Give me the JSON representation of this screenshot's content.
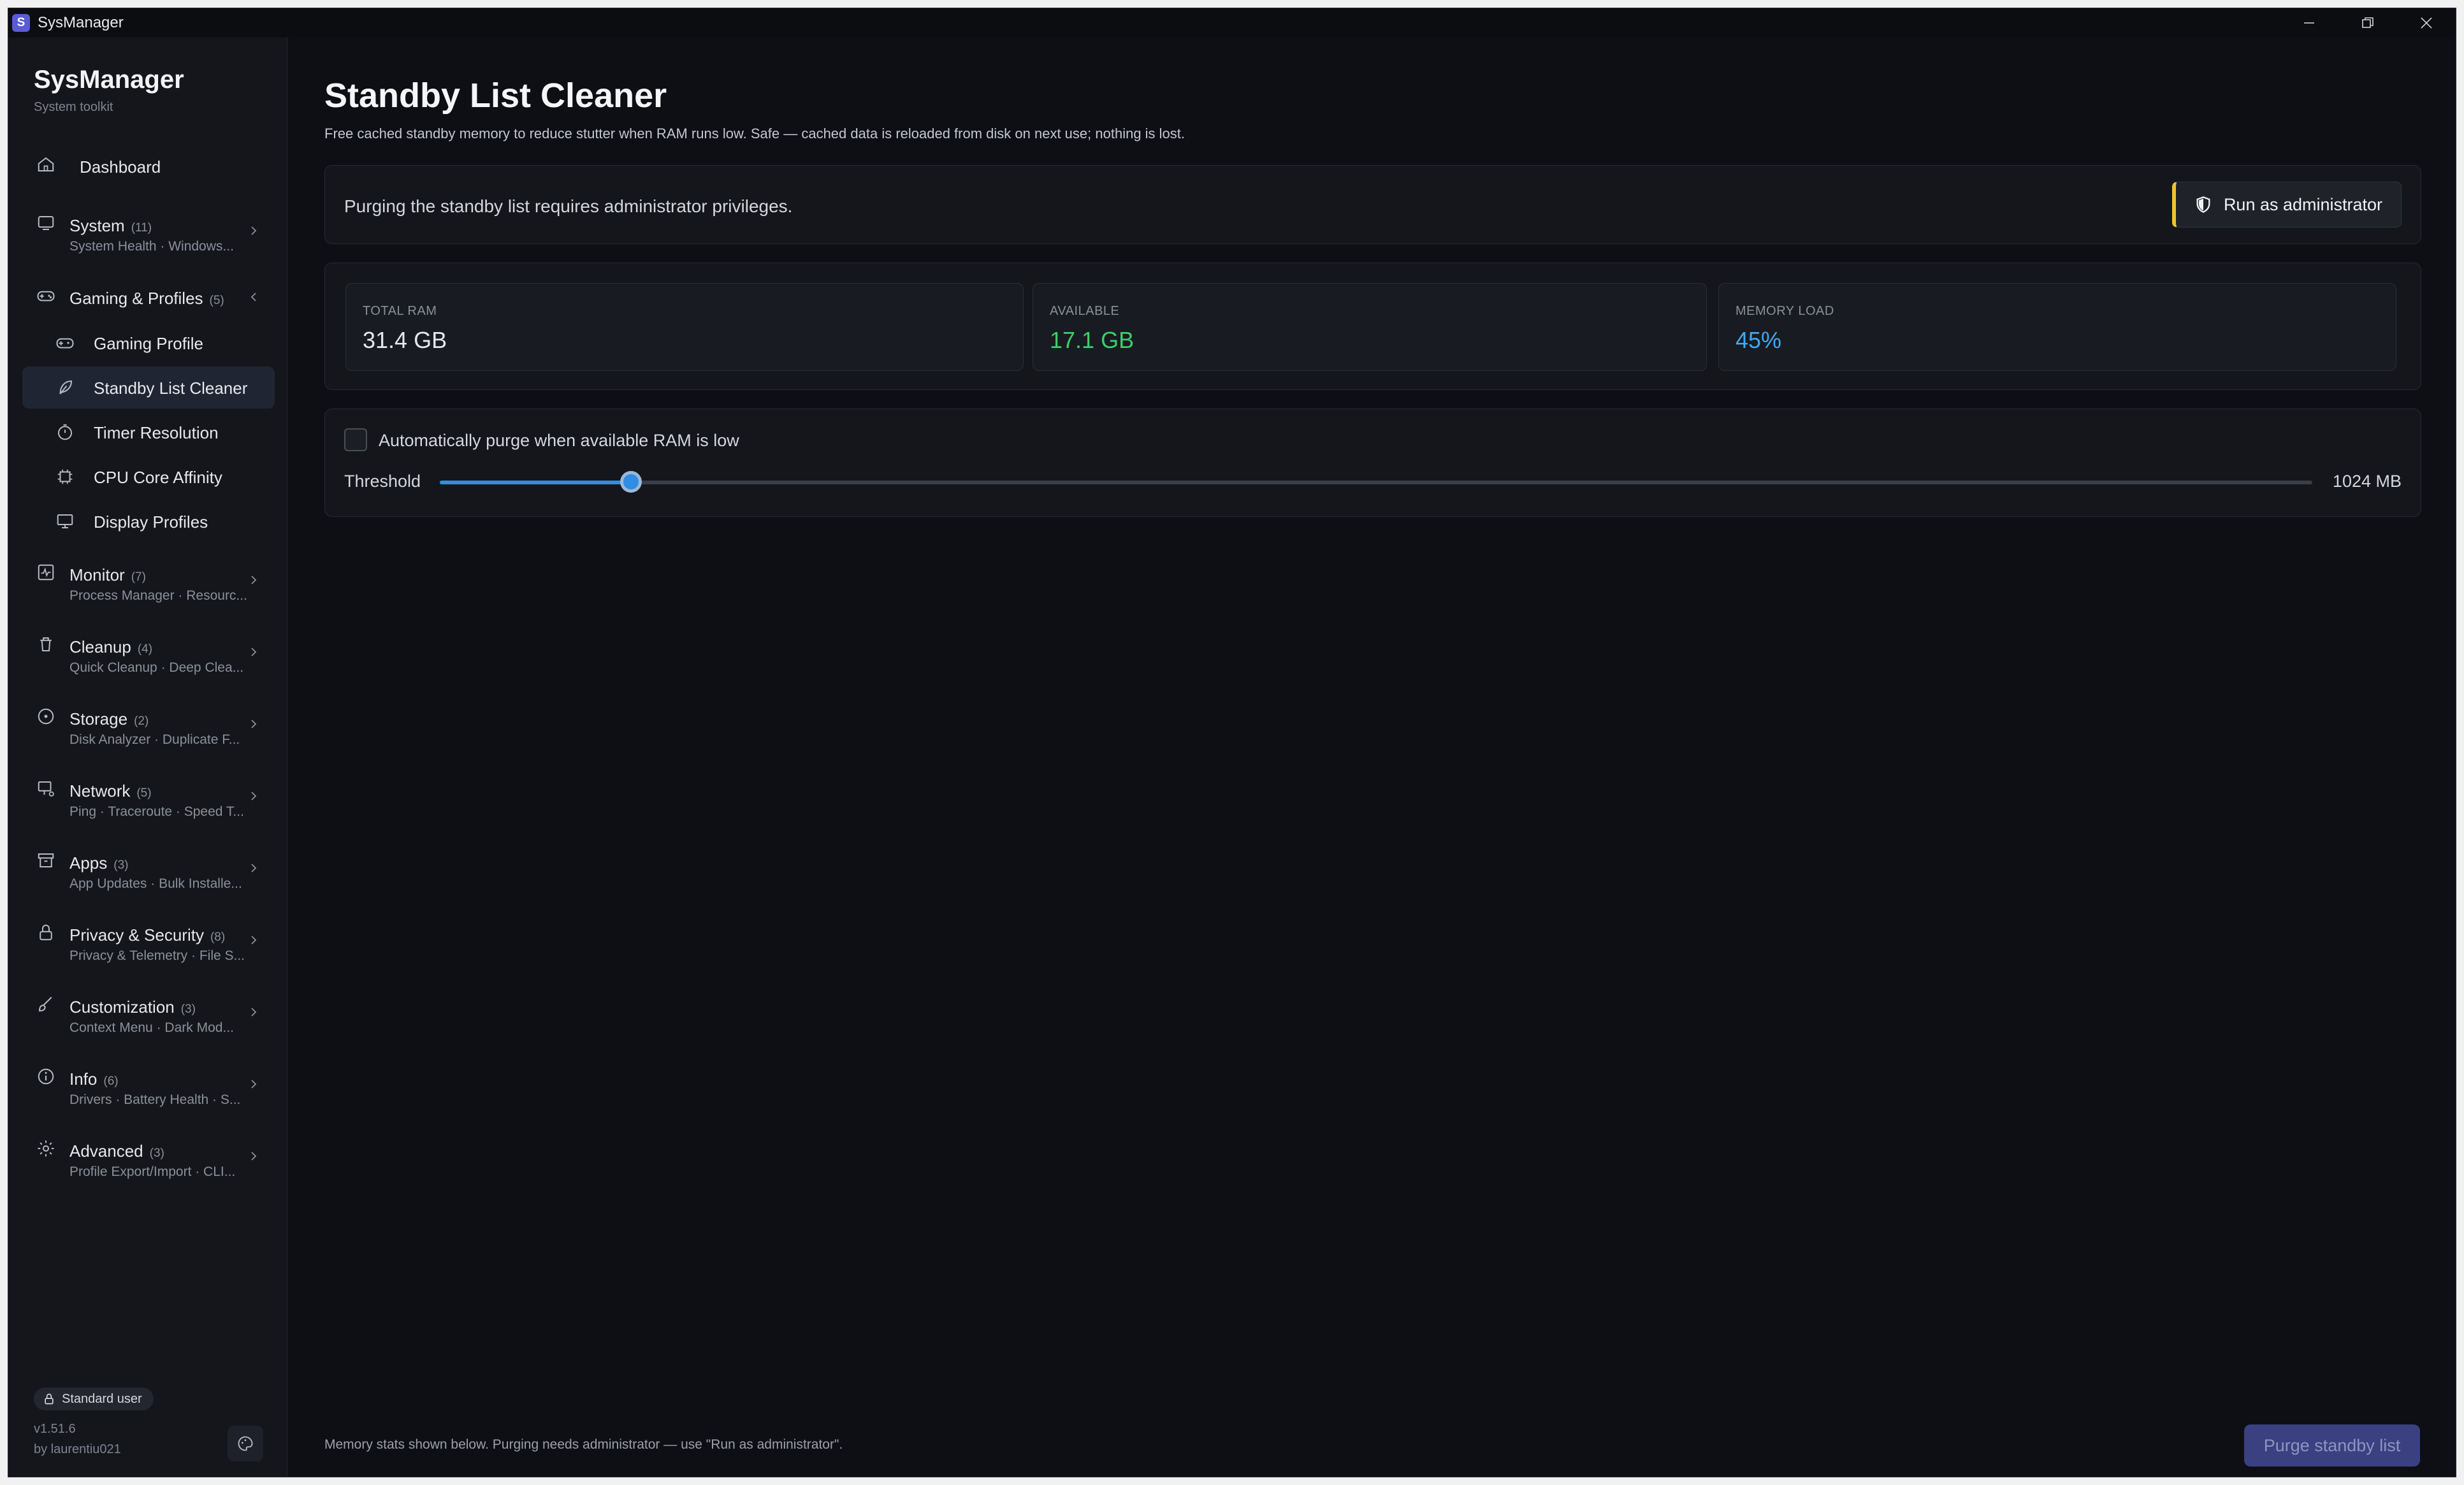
{
  "window": {
    "title": "SysManager",
    "app_icon_letter": "S"
  },
  "sidebar": {
    "brand": "SysManager",
    "brand_sub": "System toolkit",
    "dashboard": {
      "label": "Dashboard",
      "icon": "home-icon"
    },
    "groups": [
      {
        "label": "System",
        "count": "(11)",
        "sub": "System Health · Windows...",
        "icon": "system-icon"
      },
      {
        "label": "Gaming & Profiles",
        "count": "(5)",
        "icon": "gamepad-icon",
        "expanded": true
      },
      {
        "label": "Monitor",
        "count": "(7)",
        "sub": "Process Manager · Resourc...",
        "icon": "monitor-pulse-icon"
      },
      {
        "label": "Cleanup",
        "count": "(4)",
        "sub": "Quick Cleanup · Deep Clea...",
        "icon": "trash-icon"
      },
      {
        "label": "Storage",
        "count": "(2)",
        "sub": "Disk Analyzer · Duplicate F...",
        "icon": "disk-icon"
      },
      {
        "label": "Network",
        "count": "(5)",
        "sub": "Ping · Traceroute · Speed T...",
        "icon": "network-icon"
      },
      {
        "label": "Apps",
        "count": "(3)",
        "sub": "App Updates · Bulk Installe...",
        "icon": "package-icon"
      },
      {
        "label": "Privacy & Security",
        "count": "(8)",
        "sub": "Privacy & Telemetry · File S...",
        "icon": "lock-icon"
      },
      {
        "label": "Customization",
        "count": "(3)",
        "sub": "Context Menu · Dark Mod...",
        "icon": "brush-icon"
      },
      {
        "label": "Info",
        "count": "(6)",
        "sub": "Drivers · Battery Health · S...",
        "icon": "info-icon"
      },
      {
        "label": "Advanced",
        "count": "(3)",
        "sub": "Profile Export/Import · CLI...",
        "icon": "gear-icon"
      }
    ],
    "gaming_items": [
      {
        "label": "Gaming Profile",
        "icon": "gamepad-icon"
      },
      {
        "label": "Standby List Cleaner",
        "icon": "leaf-icon",
        "active": true
      },
      {
        "label": "Timer Resolution",
        "icon": "stopwatch-icon"
      },
      {
        "label": "CPU Core Affinity",
        "icon": "cpu-icon"
      },
      {
        "label": "Display Profiles",
        "icon": "display-icon"
      }
    ],
    "user_badge": "Standard user",
    "version": "v1.51.6",
    "author": "by laurentiu021"
  },
  "main": {
    "title": "Standby List Cleaner",
    "description": "Free cached standby memory to reduce stutter when RAM runs low. Safe — cached data is reloaded from disk on next use; nothing is lost.",
    "admin_message": "Purging the standby list requires administrator privileges.",
    "run_admin_label": "Run as administrator",
    "stats": [
      {
        "label": "TOTAL RAM",
        "value": "31.4 GB",
        "color": "#e6e8ec"
      },
      {
        "label": "AVAILABLE",
        "value": "17.1 GB",
        "color": "#3ccf6a"
      },
      {
        "label": "MEMORY LOAD",
        "value": "45%",
        "color": "#3fa9f5"
      }
    ],
    "auto_purge_label": "Automatically purge when available RAM is low",
    "auto_purge_checked": false,
    "threshold_label": "Threshold",
    "threshold_value": "1024 MB",
    "threshold_fraction": 0.102,
    "footer_note": "Memory stats shown below. Purging needs administrator — use \"Run as administrator\".",
    "purge_button": "Purge standby list"
  },
  "colors": {
    "accent": "#2f8de4",
    "warning": "#f2c12e",
    "purge_button": "#3b4080"
  }
}
